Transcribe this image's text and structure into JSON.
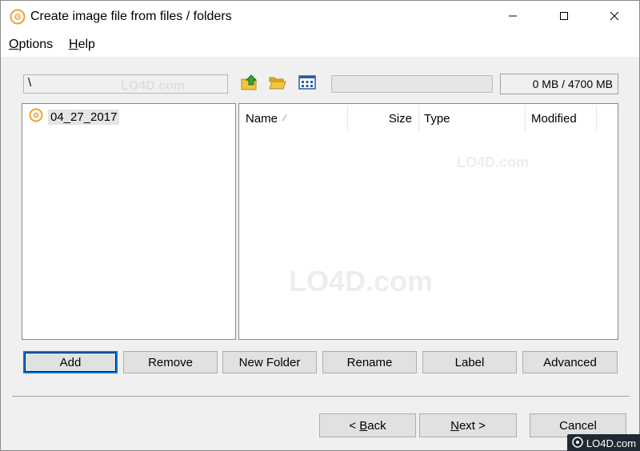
{
  "window": {
    "title": "Create image file from files / folders"
  },
  "menu": {
    "options": {
      "underline": "O",
      "rest": "ptions"
    },
    "help": {
      "underline": "H",
      "rest": "elp"
    }
  },
  "toolbar": {
    "path": "\\",
    "icons": [
      "up-folder-icon",
      "open-folder-icon",
      "view-grid-icon"
    ],
    "size_text": "0 MB / 4700 MB",
    "progress": 0
  },
  "tree": {
    "items": [
      {
        "label": "04_27_2017",
        "icon": "disc-icon"
      }
    ]
  },
  "list": {
    "columns": [
      {
        "label": "Name",
        "sort": "∕"
      },
      {
        "label": "Size"
      },
      {
        "label": "Type"
      },
      {
        "label": "Modified"
      }
    ],
    "rows": []
  },
  "actions": {
    "add": "Add",
    "remove": "Remove",
    "new_folder": "New Folder",
    "rename": "Rename",
    "label": "Label",
    "advanced": "Advanced"
  },
  "nav": {
    "back_prefix": "< ",
    "back_underline": "B",
    "back_rest": "ack",
    "next_underline": "N",
    "next_rest": "ext >",
    "cancel": "Cancel"
  },
  "watermark": {
    "text": "LO4D.com",
    "badge": "LO4D.com"
  },
  "colors": {
    "accent": "#0078d7",
    "disc_orange": "#f0a030",
    "folder_yellow": "#f4c542",
    "arrow_green": "#3aa335"
  }
}
